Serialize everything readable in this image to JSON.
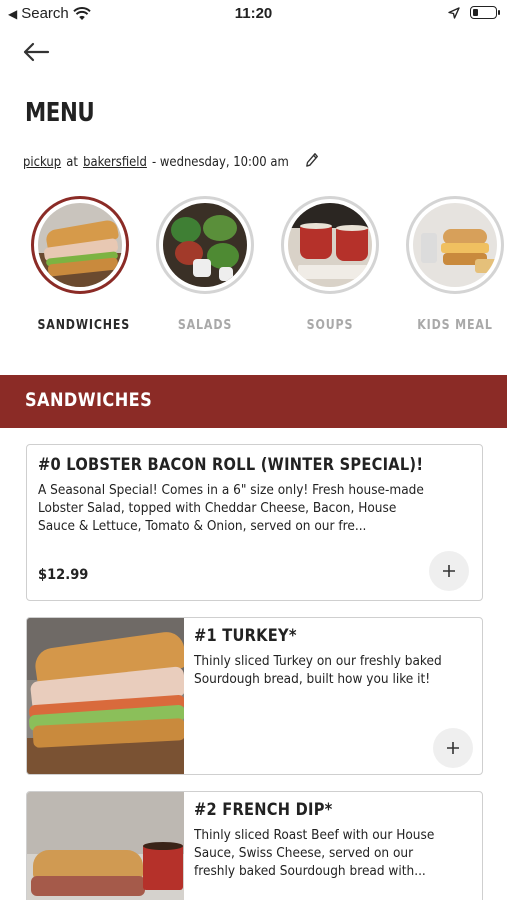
{
  "status_bar": {
    "back_label": "Search",
    "time": "11:20",
    "battery_level": 0.25
  },
  "header": {
    "title": "MENU",
    "pickup_label": "pickup",
    "at_label": "at",
    "location": "bakersfield",
    "schedule": "- wednesday, 10:00 am"
  },
  "categories": [
    {
      "label": "SANDWICHES",
      "active": true,
      "icon": "sandwich-image"
    },
    {
      "label": "SALADS",
      "active": false,
      "icon": "salad-image"
    },
    {
      "label": "SOUPS",
      "active": false,
      "icon": "soup-image"
    },
    {
      "label": "KIDS MEAL",
      "active": false,
      "icon": "kids-meal-image"
    }
  ],
  "section": {
    "title": "SANDWICHES"
  },
  "items": [
    {
      "title": "#0 LOBSTER BACON ROLL (WINTER SPECIAL)!",
      "description": "A Seasonal Special! Comes in a 6\" size only! Fresh house-made Lobster Salad, topped with Cheddar Cheese, Bacon, House Sauce & Lettuce, Tomato & Onion, served on our fre...",
      "price": "$12.99"
    },
    {
      "title": "#1 TURKEY*",
      "description": "Thinly sliced Turkey on our freshly baked Sourdough bread, built how you like it!"
    },
    {
      "title": "#2 FRENCH DIP*",
      "description": "Thinly sliced Roast Beef with our House Sauce, Swiss Cheese, served on our freshly baked Sourdough bread with..."
    }
  ],
  "colors": {
    "accent": "#8b2b26",
    "muted": "#a9a9a9"
  }
}
